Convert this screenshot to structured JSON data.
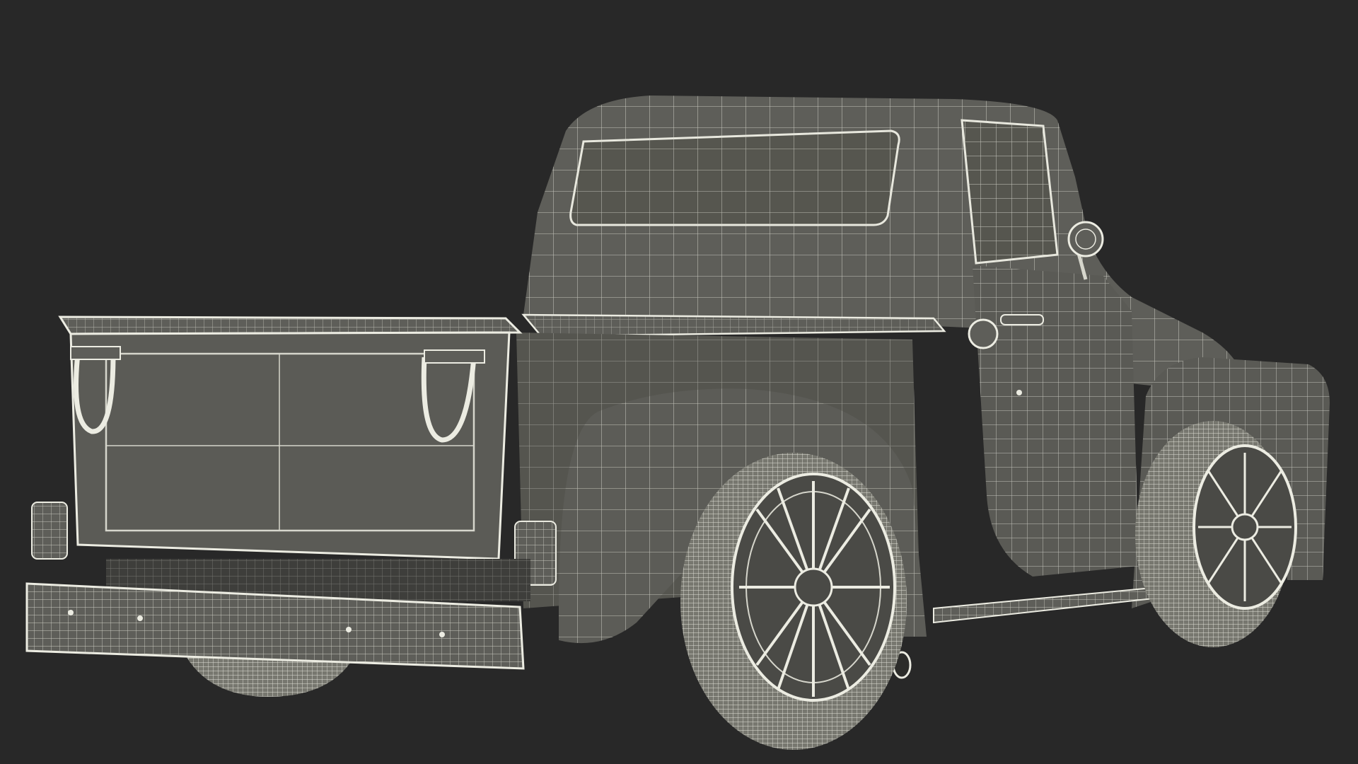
{
  "viewport": {
    "background": "#282828",
    "subject": "wireframe-pickup-truck"
  },
  "colors": {
    "body_fill": "#5e5e59",
    "body_shade": "#4e4e4a",
    "body_dark": "#3e3e3b",
    "wire": "#d6d6cc",
    "wire_dense": "#ecece2",
    "tire_fill": "#77776f",
    "rim_fill": "#4a4a46"
  }
}
